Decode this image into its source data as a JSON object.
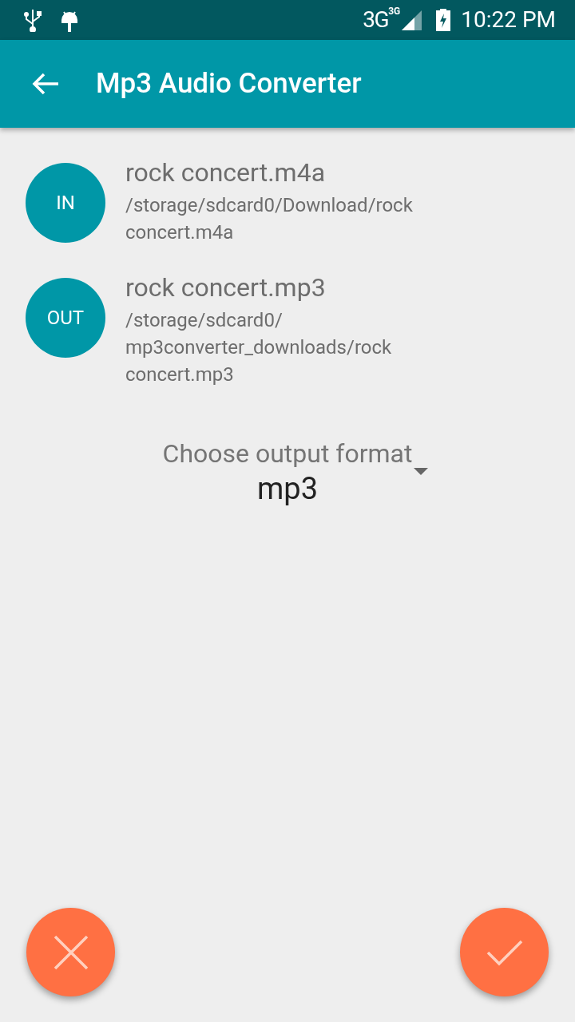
{
  "status_bar": {
    "network": "3G",
    "network_small": "3G",
    "time": "10:22 PM"
  },
  "app_bar": {
    "title": "Mp3 Audio Converter"
  },
  "files": [
    {
      "badge": "IN",
      "name": "rock concert.m4a",
      "path": "/storage/sdcard0/Download/rock concert.m4a"
    },
    {
      "badge": "OUT",
      "name": "rock concert.mp3",
      "path": "/storage/sdcard0/ mp3converter_downloads/rock concert.mp3"
    }
  ],
  "format": {
    "label": "Choose output format",
    "value": "mp3"
  }
}
